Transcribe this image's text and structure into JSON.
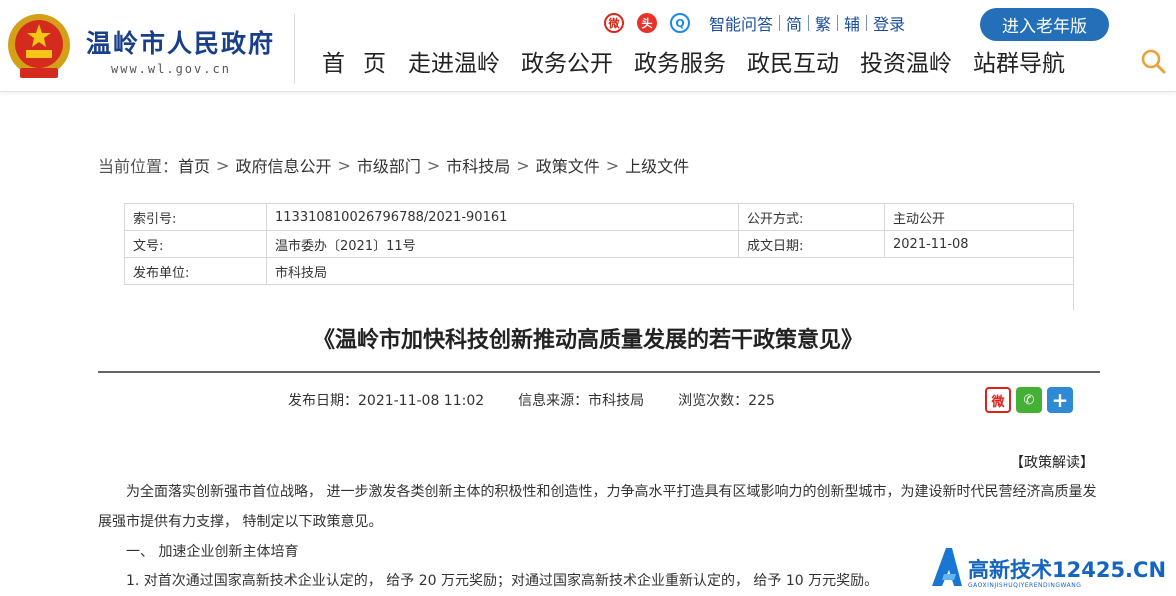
{
  "header": {
    "site_name": "温岭市人民政府",
    "site_url": "www.wl.gov.cn",
    "sns": [
      "weibo-icon",
      "toutiao-icon",
      "qq-icon"
    ],
    "toplinks": [
      "智能问答",
      "简",
      "繁",
      "辅",
      "登录"
    ],
    "elder_button": "进入老年版",
    "nav": [
      "首页",
      "走进温岭",
      "政务公开",
      "政务服务",
      "政民互动",
      "投资温岭",
      "站群导航"
    ],
    "accent_color": "#2470b8"
  },
  "breadcrumb": {
    "label": "当前位置：",
    "items": [
      "首页",
      "政府信息公开",
      "市级部门",
      "市科技局",
      "政策文件",
      "上级文件"
    ],
    "separator": ">"
  },
  "meta": {
    "index_label": "索引号:",
    "index_value": "113310810026796788/2021-90161",
    "publicity_label": "公开方式:",
    "publicity_value": "主动公开",
    "docno_label": "文号:",
    "docno_value": "温市委办〔2021〕11号",
    "date_label": "成文日期:",
    "date_value": "2021-11-08",
    "publisher_label": "发布单位:",
    "publisher_value": "市科技局"
  },
  "article": {
    "title": "《温岭市加快科技创新推动高质量发展的若干政策意见》",
    "pub_date": "发布日期：2021-11-08 11:02",
    "source": "信息来源：市科技局",
    "views": "浏览次数：225",
    "interpret_link": "【政策解读】",
    "paragraph1": "为全面落实创新强市首位战略， 进一步激发各类创新主体的积极性和创造性，力争高水平打造具有区域影响力的创新型城市，为建设新时代民营经济高质量发展强市提供有力支撑， 特制定以下政策意见。",
    "section1": "一、 加速企业创新主体培育",
    "item1": "1. 对首次通过国家高新技术企业认定的， 给予 20 万元奖励；对通过国家高新技术企业重新认定的， 给予 10 万元奖励。"
  },
  "watermark": {
    "text": "高新技术12425.CN",
    "sub": "GAOXINJISHUQIYERENDINGWANG"
  }
}
